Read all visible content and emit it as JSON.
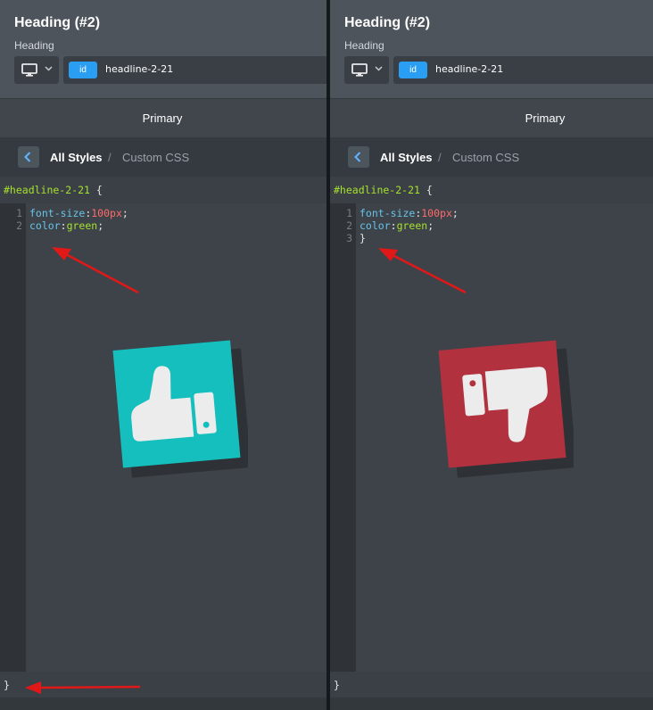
{
  "panels": [
    {
      "header": {
        "title": "Heading (#2)",
        "subtitle": "Heading",
        "id_badge": "id",
        "selector": "headline-2-21"
      },
      "tabs": {
        "primary": "Primary"
      },
      "breadcrumb": {
        "all_styles": "All Styles",
        "separator": "/",
        "custom_css": "Custom CSS"
      },
      "editor": {
        "selector": "#headline-2-21",
        "open_brace": " {",
        "lines": [
          {
            "num": "1",
            "prop": "font-size",
            "colon": ":",
            "value": "100px",
            "end": ";"
          },
          {
            "num": "2",
            "prop": "color",
            "colon": ":",
            "value": "green",
            "end": ";"
          }
        ],
        "closing_brace": "}"
      },
      "verdict_icon": "thumbs-up-icon",
      "verdict_color": "#14bfbd"
    },
    {
      "header": {
        "title": "Heading (#2)",
        "subtitle": "Heading",
        "id_badge": "id",
        "selector": "headline-2-21"
      },
      "tabs": {
        "primary": "Primary"
      },
      "breadcrumb": {
        "all_styles": "All Styles",
        "separator": "/",
        "custom_css": "Custom CSS"
      },
      "editor": {
        "selector": "#headline-2-21",
        "open_brace": " {",
        "lines": [
          {
            "num": "1",
            "prop": "font-size",
            "colon": ":",
            "value": "100px",
            "end": ";"
          },
          {
            "num": "2",
            "prop": "color",
            "colon": ":",
            "value": "green",
            "end": ";"
          },
          {
            "num": "3",
            "brace": "}"
          }
        ],
        "closing_brace": "}"
      },
      "verdict_icon": "thumbs-down-icon",
      "verdict_color": "#b2313f"
    }
  ],
  "annotation_color": "#e01818"
}
